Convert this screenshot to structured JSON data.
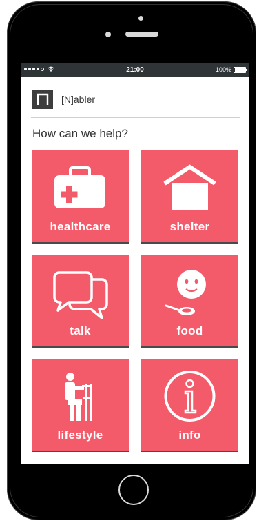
{
  "status_bar": {
    "time": "21:00",
    "battery": "100%",
    "signal_icon": "signal-dots-icon",
    "wifi_icon": "wifi-icon",
    "battery_icon": "battery-icon"
  },
  "header": {
    "app_name": "[N]abler",
    "logo_icon": "nabler-logo-icon"
  },
  "prompt": "How can we help?",
  "tiles": [
    {
      "label": "healthcare",
      "icon": "first-aid-kit-icon"
    },
    {
      "label": "shelter",
      "icon": "house-icon"
    },
    {
      "label": "talk",
      "icon": "speech-bubbles-icon"
    },
    {
      "label": "food",
      "icon": "face-spoon-icon"
    },
    {
      "label": "lifestyle",
      "icon": "person-crutches-icon"
    },
    {
      "label": "info",
      "icon": "info-icon"
    }
  ],
  "colors": {
    "tile": "#f45b6a",
    "status_bar": "#2f3437",
    "phone_body": "#000000"
  }
}
